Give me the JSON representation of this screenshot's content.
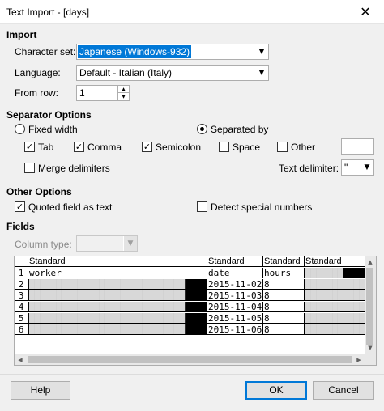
{
  "window": {
    "title": "Text Import - [days]",
    "close_glyph": "✕"
  },
  "import": {
    "heading": "Import",
    "charset_label": "Character set:",
    "charset_value": "Japanese (Windows-932)",
    "language_label": "Language:",
    "language_value": "Default - Italian (Italy)",
    "from_row_label": "From row:",
    "from_row_value": "1"
  },
  "separator": {
    "heading": "Separator Options",
    "fixed_width": "Fixed width",
    "separated_by": "Separated by",
    "mode": "separated_by",
    "tab": {
      "label": "Tab",
      "checked": true
    },
    "comma": {
      "label": "Comma",
      "checked": true
    },
    "semicolon": {
      "label": "Semicolon",
      "checked": true
    },
    "space": {
      "label": "Space",
      "checked": false
    },
    "other": {
      "label": "Other",
      "checked": false,
      "value": ""
    },
    "merge": {
      "label": "Merge delimiters",
      "checked": false
    },
    "text_delim_label": "Text delimiter:",
    "text_delim_value": "\""
  },
  "other_options": {
    "heading": "Other Options",
    "quoted": {
      "label": "Quoted field as text",
      "checked": true
    },
    "detect": {
      "label": "Detect special numbers",
      "checked": false
    }
  },
  "fields": {
    "heading": "Fields",
    "column_type_label": "Column type:",
    "column_type_value": "",
    "headers": [
      "Standard",
      "Standard",
      "Standard",
      "Standard"
    ],
    "rows": [
      {
        "num": "1",
        "c1": "worker",
        "c2": "date",
        "c3": "hours",
        "c4": "███████"
      },
      {
        "num": "2",
        "c1": "█████████████████████████████",
        "c2": "2015-11-02",
        "c3": "8",
        "c4": "███████████"
      },
      {
        "num": "3",
        "c1": "█████████████████████████████",
        "c2": "2015-11-03",
        "c3": "8",
        "c4": "███████████"
      },
      {
        "num": "4",
        "c1": "█████████████████████████████",
        "c2": "2015-11-04",
        "c3": "8",
        "c4": "███████████"
      },
      {
        "num": "5",
        "c1": "█████████████████████████████",
        "c2": "2015-11-05",
        "c3": "8",
        "c4": "███████████"
      },
      {
        "num": "6",
        "c1": "█████████████████████████████",
        "c2": "2015-11-06",
        "c3": "8",
        "c4": "███████████"
      }
    ]
  },
  "buttons": {
    "help": "Help",
    "ok": "OK",
    "cancel": "Cancel"
  },
  "icons": {
    "dropdown": "▼",
    "spin_up": "▲",
    "spin_down": "▼",
    "check": "✓",
    "scroll_left": "◀",
    "scroll_right": "▶",
    "scroll_up": "▲",
    "scroll_down": "▼"
  },
  "colors": {
    "selection": "#0078d7",
    "dialog_bg": "#f0f0f0",
    "redacted": "#000000"
  }
}
